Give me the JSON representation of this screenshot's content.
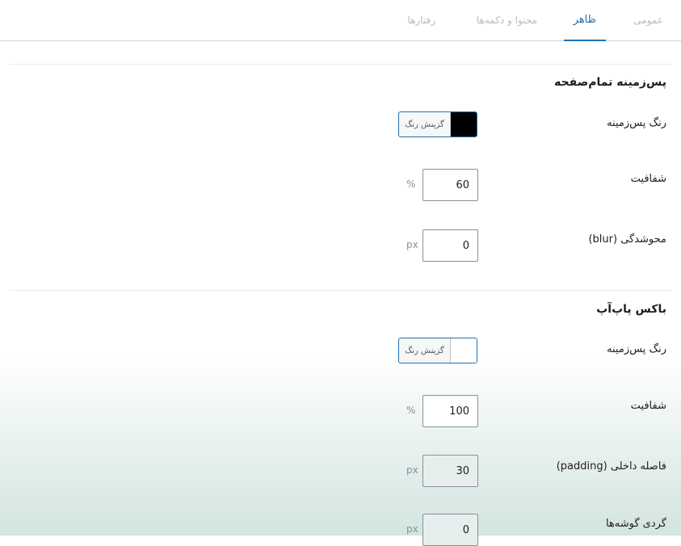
{
  "tabs": [
    {
      "label": "عمومی",
      "active": false
    },
    {
      "label": "ظاهر",
      "active": true
    },
    {
      "label": "محتوا و دکمه‌ها",
      "active": false
    },
    {
      "label": "رفتارها",
      "active": false
    }
  ],
  "overlay_section": {
    "title": "پس‌زمینه تمام‌صفحه",
    "bg_color_label": "رنگ پس‌زمینه",
    "bg_color_button": "گزینش رنگ",
    "bg_color_value": "#000000",
    "opacity_label": "شفافیت",
    "opacity_value": "60",
    "opacity_unit": "%",
    "blur_label": "محوشدگی (blur)",
    "blur_value": "0",
    "blur_unit": "px"
  },
  "popup_section": {
    "title": "باکس پاپ‌آپ",
    "bg_color_label": "رنگ پس‌زمینه",
    "bg_color_button": "گزینش رنگ",
    "bg_color_value": "#ffffff",
    "opacity_label": "شفافیت",
    "opacity_value": "100",
    "opacity_unit": "%",
    "padding_label": "فاصله داخلی (padding)",
    "padding_value": "30",
    "padding_unit": "px",
    "radius_label": "گردی گوشه‌ها",
    "radius_value": "0",
    "radius_unit": "px"
  },
  "colors": {
    "accent": "#2271b1",
    "bottom_tint": "#d3e5e1"
  }
}
